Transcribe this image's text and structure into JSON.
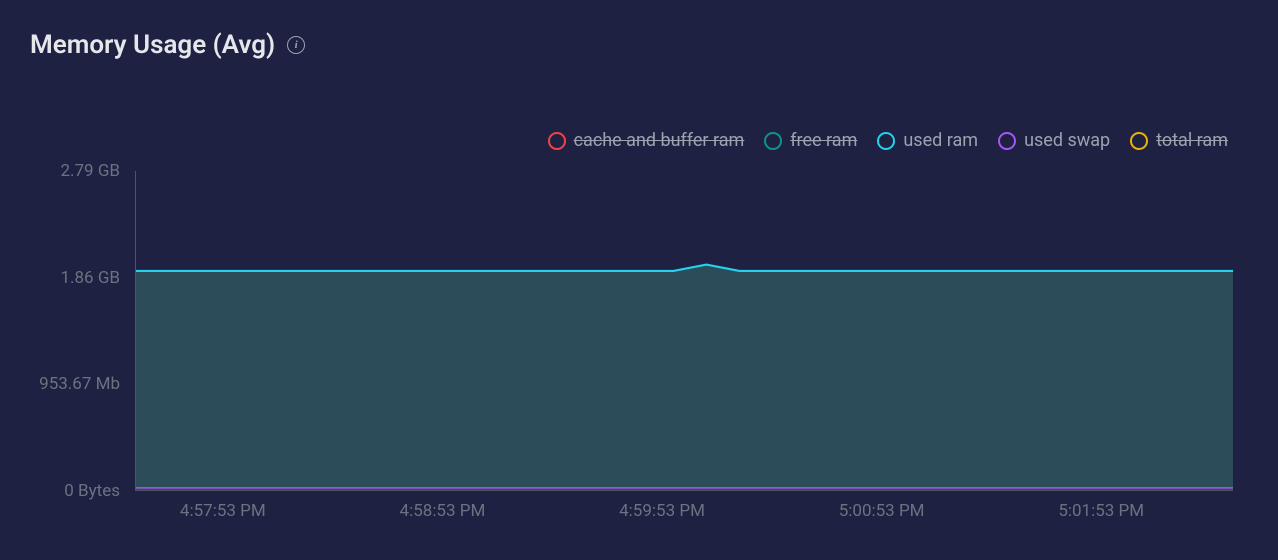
{
  "header": {
    "title": "Memory Usage (Avg)"
  },
  "legend": {
    "items": [
      {
        "label": "cache and buffer ram",
        "color": "#ef4444",
        "struck": true
      },
      {
        "label": "free ram",
        "color": "#0d9488",
        "struck": true
      },
      {
        "label": "used ram",
        "color": "#22d3ee",
        "struck": false
      },
      {
        "label": "used swap",
        "color": "#a855f7",
        "struck": false
      },
      {
        "label": "total ram",
        "color": "#eab308",
        "struck": true
      }
    ]
  },
  "y_axis": {
    "ticks": [
      {
        "label": "2.79 GB",
        "pos": 0
      },
      {
        "label": "1.86 GB",
        "pos": 33.33
      },
      {
        "label": "953.67 Mb",
        "pos": 66.67
      },
      {
        "label": "0 Bytes",
        "pos": 100
      }
    ]
  },
  "x_axis": {
    "ticks": [
      {
        "label": "4:57:53 PM",
        "pos": 8
      },
      {
        "label": "4:58:53 PM",
        "pos": 28
      },
      {
        "label": "4:59:53 PM",
        "pos": 48
      },
      {
        "label": "5:00:53 PM",
        "pos": 68
      },
      {
        "label": "5:01:53 PM",
        "pos": 88
      }
    ]
  },
  "chart_data": {
    "type": "area",
    "title": "Memory Usage (Avg)",
    "xlabel": "",
    "ylabel": "",
    "ylim": [
      0,
      2.79
    ],
    "y_ticks_labels": [
      "0 Bytes",
      "953.67 Mb",
      "1.86 GB",
      "2.79 GB"
    ],
    "x": [
      "4:57:53 PM",
      "4:58:23 PM",
      "4:58:53 PM",
      "4:59:23 PM",
      "4:59:53 PM",
      "5:00:08 PM",
      "5:00:23 PM",
      "5:00:53 PM",
      "5:01:23 PM",
      "5:01:53 PM",
      "5:02:23 PM"
    ],
    "series": [
      {
        "name": "used ram",
        "color": "#22d3ee",
        "visible": true,
        "values_gb": [
          1.92,
          1.92,
          1.92,
          1.92,
          1.92,
          1.96,
          1.92,
          1.92,
          1.92,
          1.92,
          1.92
        ]
      },
      {
        "name": "used swap",
        "color": "#a855f7",
        "visible": true,
        "values_gb": [
          0.02,
          0.02,
          0.02,
          0.02,
          0.02,
          0.02,
          0.02,
          0.02,
          0.02,
          0.02,
          0.02
        ]
      },
      {
        "name": "cache and buffer ram",
        "color": "#ef4444",
        "visible": false,
        "values_gb": null
      },
      {
        "name": "free ram",
        "color": "#0d9488",
        "visible": false,
        "values_gb": null
      },
      {
        "name": "total ram",
        "color": "#eab308",
        "visible": false,
        "values_gb": null
      }
    ]
  }
}
